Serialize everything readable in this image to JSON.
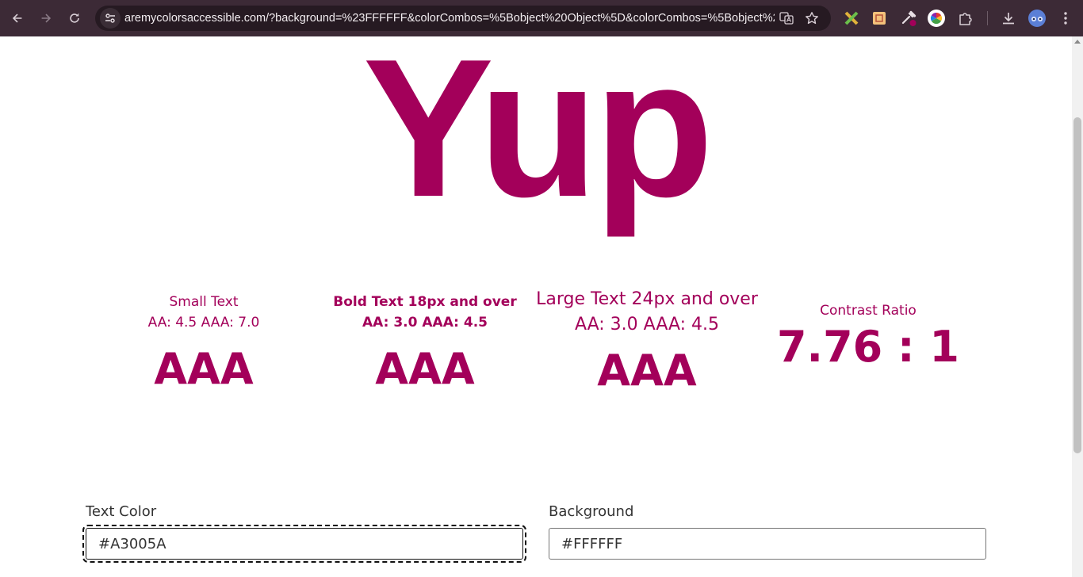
{
  "browser": {
    "url": "aremycolorsaccessible.com/?background=%23FFFFFF&colorCombos=%5Bobject%20Object%5D&colorCombos=%5Bobject%20O..."
  },
  "icons": {
    "back": "back-arrow-icon",
    "forward": "forward-arrow-icon",
    "reload": "reload-icon",
    "site_info": "tune-icon",
    "translate": "translate-icon",
    "bookmark": "star-icon",
    "extensions": "puzzle-icon",
    "downloads": "download-icon",
    "menu": "kebab-menu-icon"
  },
  "colors": {
    "text": "#A3005A",
    "background": "#FFFFFF"
  },
  "result": {
    "verdict": "Yup"
  },
  "criteria": [
    {
      "title": "Small Text",
      "thresholds": "AA: 4.5 AAA: 7.0",
      "grade": "AAA"
    },
    {
      "title": "Bold Text 18px and over",
      "thresholds": "AA: 3.0 AAA: 4.5",
      "grade": "AAA"
    },
    {
      "title": "Large Text 24px and over",
      "thresholds": "AA: 3.0 AAA: 4.5",
      "grade": "AAA"
    }
  ],
  "contrast": {
    "label": "Contrast Ratio",
    "value": "7.76 : 1"
  },
  "form": {
    "text_color_label": "Text Color",
    "text_color_value": "#A3005A",
    "background_label": "Background",
    "background_value": "#FFFFFF"
  }
}
